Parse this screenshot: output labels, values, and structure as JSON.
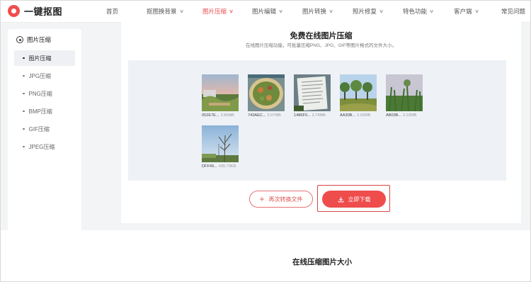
{
  "app": {
    "name": "一键抠图"
  },
  "nav": [
    {
      "label": "首页",
      "chevron": false,
      "active": false
    },
    {
      "label": "抠图换背景",
      "chevron": true,
      "active": false
    },
    {
      "label": "图片压缩",
      "chevron": true,
      "active": true
    },
    {
      "label": "图片编辑",
      "chevron": true,
      "active": false
    },
    {
      "label": "图片转换",
      "chevron": true,
      "active": false
    },
    {
      "label": "照片修复",
      "chevron": true,
      "active": false
    },
    {
      "label": "特色功能",
      "chevron": true,
      "active": false
    },
    {
      "label": "客户端",
      "chevron": true,
      "active": false
    },
    {
      "label": "常见问题",
      "chevron": false,
      "active": false
    }
  ],
  "sidebar": {
    "title": "图片压缩",
    "items": [
      {
        "label": "图片压缩",
        "active": true
      },
      {
        "label": "JPG压缩",
        "active": false
      },
      {
        "label": "PNG压缩",
        "active": false
      },
      {
        "label": "BMP压缩",
        "active": false
      },
      {
        "label": "GIF压缩",
        "active": false
      },
      {
        "label": "JPEG压缩",
        "active": false
      }
    ]
  },
  "main": {
    "title": "免费在线图片压缩",
    "subtitle": "在线图片压缩功能，可批量压缩PNG、JPG、GIF等图片格式的文件大小。",
    "files": [
      {
        "name": "052E7E...",
        "size": "2.86MB",
        "kind": "sunset-garden"
      },
      {
        "name": "743AEC...",
        "size": "2.07MB",
        "kind": "food-plate"
      },
      {
        "name": "1486F0...",
        "size": "3.74MB",
        "kind": "document"
      },
      {
        "name": "AA30B...",
        "size": "2.92MB",
        "kind": "trees-field"
      },
      {
        "name": "AB03B...",
        "size": "3.22MB",
        "kind": "corn-field"
      },
      {
        "name": "DFF49...",
        "size": "435.73KB",
        "kind": "tree-sky"
      }
    ],
    "convert_again_label": "再次转换文件",
    "download_label": "立即下载"
  },
  "section": {
    "title": "在线压缩图片大小"
  },
  "colors": {
    "accent": "#ef4c4c",
    "gallery_bg": "#eef1f6",
    "page_bg": "#f3f4f6"
  }
}
